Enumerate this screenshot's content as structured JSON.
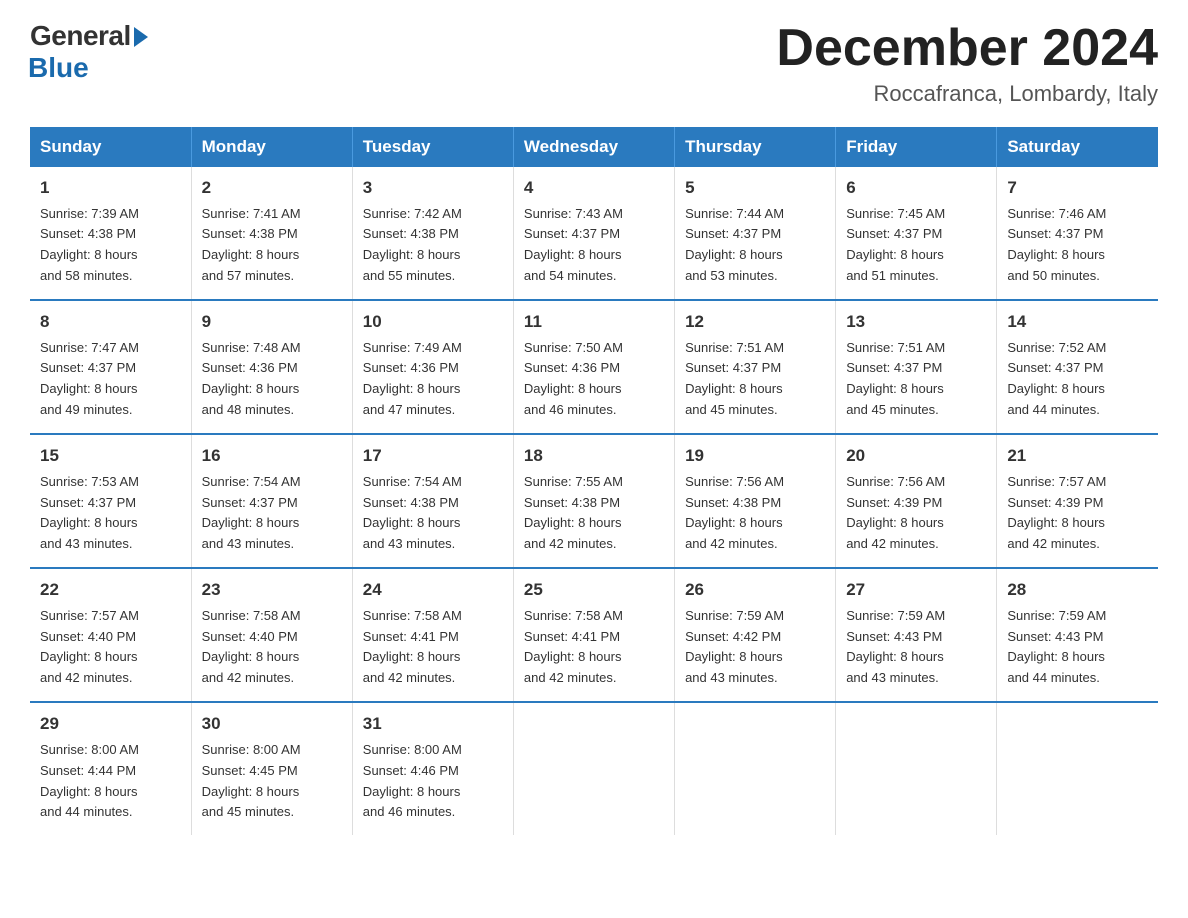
{
  "logo": {
    "general": "General",
    "blue": "Blue"
  },
  "title": "December 2024",
  "location": "Roccafranca, Lombardy, Italy",
  "days_of_week": [
    "Sunday",
    "Monday",
    "Tuesday",
    "Wednesday",
    "Thursday",
    "Friday",
    "Saturday"
  ],
  "weeks": [
    [
      {
        "day": "1",
        "sunrise": "7:39 AM",
        "sunset": "4:38 PM",
        "daylight": "8 hours and 58 minutes."
      },
      {
        "day": "2",
        "sunrise": "7:41 AM",
        "sunset": "4:38 PM",
        "daylight": "8 hours and 57 minutes."
      },
      {
        "day": "3",
        "sunrise": "7:42 AM",
        "sunset": "4:38 PM",
        "daylight": "8 hours and 55 minutes."
      },
      {
        "day": "4",
        "sunrise": "7:43 AM",
        "sunset": "4:37 PM",
        "daylight": "8 hours and 54 minutes."
      },
      {
        "day": "5",
        "sunrise": "7:44 AM",
        "sunset": "4:37 PM",
        "daylight": "8 hours and 53 minutes."
      },
      {
        "day": "6",
        "sunrise": "7:45 AM",
        "sunset": "4:37 PM",
        "daylight": "8 hours and 51 minutes."
      },
      {
        "day": "7",
        "sunrise": "7:46 AM",
        "sunset": "4:37 PM",
        "daylight": "8 hours and 50 minutes."
      }
    ],
    [
      {
        "day": "8",
        "sunrise": "7:47 AM",
        "sunset": "4:37 PM",
        "daylight": "8 hours and 49 minutes."
      },
      {
        "day": "9",
        "sunrise": "7:48 AM",
        "sunset": "4:36 PM",
        "daylight": "8 hours and 48 minutes."
      },
      {
        "day": "10",
        "sunrise": "7:49 AM",
        "sunset": "4:36 PM",
        "daylight": "8 hours and 47 minutes."
      },
      {
        "day": "11",
        "sunrise": "7:50 AM",
        "sunset": "4:36 PM",
        "daylight": "8 hours and 46 minutes."
      },
      {
        "day": "12",
        "sunrise": "7:51 AM",
        "sunset": "4:37 PM",
        "daylight": "8 hours and 45 minutes."
      },
      {
        "day": "13",
        "sunrise": "7:51 AM",
        "sunset": "4:37 PM",
        "daylight": "8 hours and 45 minutes."
      },
      {
        "day": "14",
        "sunrise": "7:52 AM",
        "sunset": "4:37 PM",
        "daylight": "8 hours and 44 minutes."
      }
    ],
    [
      {
        "day": "15",
        "sunrise": "7:53 AM",
        "sunset": "4:37 PM",
        "daylight": "8 hours and 43 minutes."
      },
      {
        "day": "16",
        "sunrise": "7:54 AM",
        "sunset": "4:37 PM",
        "daylight": "8 hours and 43 minutes."
      },
      {
        "day": "17",
        "sunrise": "7:54 AM",
        "sunset": "4:38 PM",
        "daylight": "8 hours and 43 minutes."
      },
      {
        "day": "18",
        "sunrise": "7:55 AM",
        "sunset": "4:38 PM",
        "daylight": "8 hours and 42 minutes."
      },
      {
        "day": "19",
        "sunrise": "7:56 AM",
        "sunset": "4:38 PM",
        "daylight": "8 hours and 42 minutes."
      },
      {
        "day": "20",
        "sunrise": "7:56 AM",
        "sunset": "4:39 PM",
        "daylight": "8 hours and 42 minutes."
      },
      {
        "day": "21",
        "sunrise": "7:57 AM",
        "sunset": "4:39 PM",
        "daylight": "8 hours and 42 minutes."
      }
    ],
    [
      {
        "day": "22",
        "sunrise": "7:57 AM",
        "sunset": "4:40 PM",
        "daylight": "8 hours and 42 minutes."
      },
      {
        "day": "23",
        "sunrise": "7:58 AM",
        "sunset": "4:40 PM",
        "daylight": "8 hours and 42 minutes."
      },
      {
        "day": "24",
        "sunrise": "7:58 AM",
        "sunset": "4:41 PM",
        "daylight": "8 hours and 42 minutes."
      },
      {
        "day": "25",
        "sunrise": "7:58 AM",
        "sunset": "4:41 PM",
        "daylight": "8 hours and 42 minutes."
      },
      {
        "day": "26",
        "sunrise": "7:59 AM",
        "sunset": "4:42 PM",
        "daylight": "8 hours and 43 minutes."
      },
      {
        "day": "27",
        "sunrise": "7:59 AM",
        "sunset": "4:43 PM",
        "daylight": "8 hours and 43 minutes."
      },
      {
        "day": "28",
        "sunrise": "7:59 AM",
        "sunset": "4:43 PM",
        "daylight": "8 hours and 44 minutes."
      }
    ],
    [
      {
        "day": "29",
        "sunrise": "8:00 AM",
        "sunset": "4:44 PM",
        "daylight": "8 hours and 44 minutes."
      },
      {
        "day": "30",
        "sunrise": "8:00 AM",
        "sunset": "4:45 PM",
        "daylight": "8 hours and 45 minutes."
      },
      {
        "day": "31",
        "sunrise": "8:00 AM",
        "sunset": "4:46 PM",
        "daylight": "8 hours and 46 minutes."
      },
      null,
      null,
      null,
      null
    ]
  ],
  "labels": {
    "sunrise": "Sunrise:",
    "sunset": "Sunset:",
    "daylight": "Daylight:"
  }
}
